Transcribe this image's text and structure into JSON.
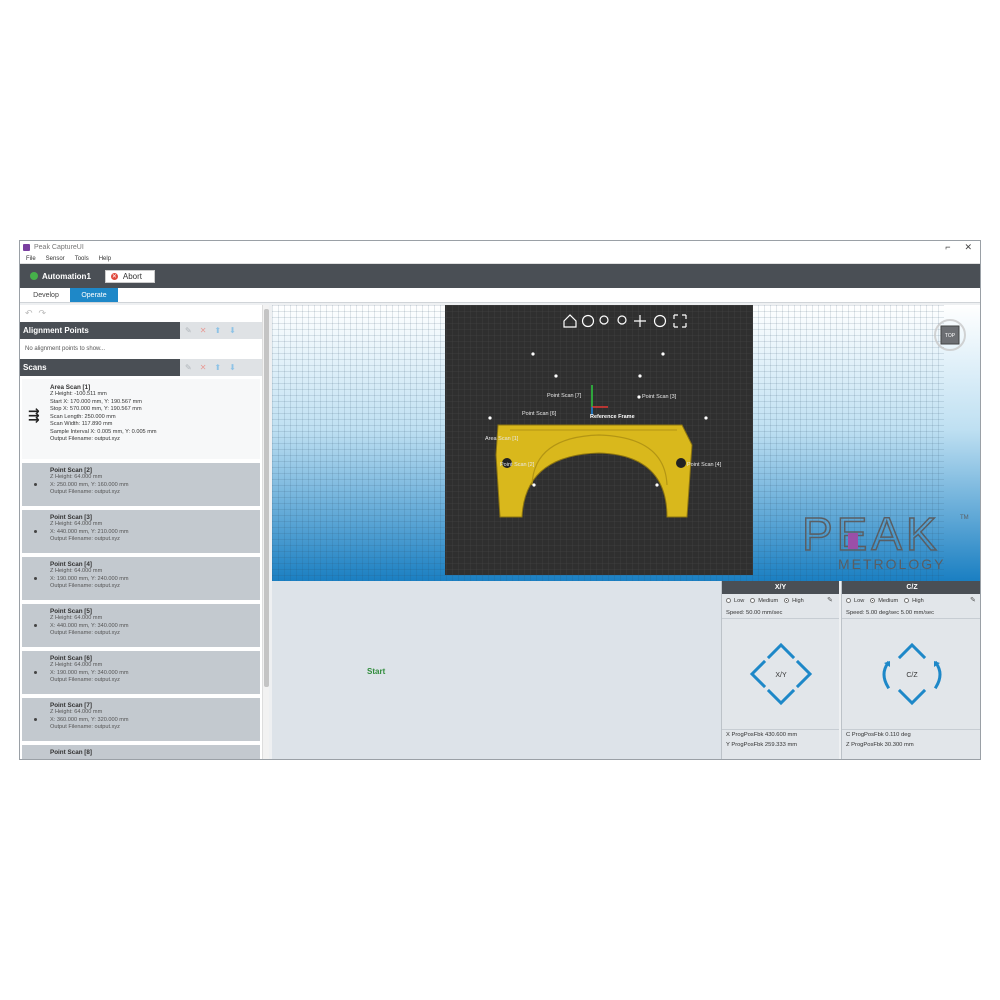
{
  "window": {
    "title": "Peak CaptureUI",
    "min_glyph": "⌐",
    "close_glyph": "✕"
  },
  "menu": [
    "File",
    "Sensor",
    "Tools",
    "Help"
  ],
  "automation": {
    "name": "Automation1",
    "abort_label": "Abort"
  },
  "tabs": [
    {
      "label": "Develop",
      "active": false
    },
    {
      "label": "Operate",
      "active": true
    }
  ],
  "alignment": {
    "title": "Alignment Points",
    "empty_text": "No alignment points to show..."
  },
  "scans": {
    "title": "Scans",
    "items": [
      {
        "name": "Area Scan [1]",
        "lines": [
          "Z Height: -100.511 mm",
          "Start X: 170.000 mm, Y: 190.567 mm",
          "Stop X: 570.000 mm, Y: 190.567 mm",
          "Scan Length: 250.000 mm",
          "Scan Width: 117.890 mm",
          "Sample Interval X: 0.005 mm, Y: 0.005 mm",
          "Output Filename: output.xyz"
        ]
      },
      {
        "name": "Point Scan [2]",
        "lines": [
          "Z Height: 64.000 mm",
          "X: 250.000 mm, Y: 160.000 mm",
          "Output Filename: output.xyz"
        ]
      },
      {
        "name": "Point Scan [3]",
        "lines": [
          "Z Height: 64.000 mm",
          "X: 440.000 mm, Y: 210.000 mm",
          "Output Filename: output.xyz"
        ]
      },
      {
        "name": "Point Scan [4]",
        "lines": [
          "Z Height: 64.000 mm",
          "X: 190.000 mm, Y: 240.000 mm",
          "Output Filename: output.xyz"
        ]
      },
      {
        "name": "Point Scan [5]",
        "lines": [
          "Z Height: 64.000 mm",
          "X: 440.000 mm, Y: 340.000 mm",
          "Output Filename: output.xyz"
        ]
      },
      {
        "name": "Point Scan [6]",
        "lines": [
          "Z Height: 64.000 mm",
          "X: 190.000 mm, Y: 340.000 mm",
          "Output Filename: output.xyz"
        ]
      },
      {
        "name": "Point Scan [7]",
        "lines": [
          "Z Height: 64.000 mm",
          "X: 360.000 mm, Y: 320.000 mm",
          "Output Filename: output.xyz"
        ]
      },
      {
        "name": "Point Scan [8]",
        "lines": []
      }
    ]
  },
  "viewport": {
    "cube_label": "TOP",
    "part_color": "#d9b81c",
    "labels": [
      "Point Scan [7]",
      "Point Scan [6]",
      "Point Scan [3]",
      "Area Scan [1]",
      "Point Scan [2]",
      "Point Scan [4]",
      "Reference Frame"
    ],
    "icons": [
      "home-icon",
      "orbit-icon",
      "zoom-window-icon",
      "zoom-icon",
      "pan-icon",
      "rotate-icon",
      "fit-icon"
    ]
  },
  "brand": {
    "peak": "PEAK",
    "metrology": "METROLOGY",
    "tm": "TM"
  },
  "start_label": "Start",
  "xy": {
    "title": "X/Y",
    "options": [
      "Low",
      "Medium",
      "High"
    ],
    "selected": "High",
    "speed": "Speed: 50.00 mm/sec",
    "pad_label": "X/Y",
    "pos_x": "X ProgPosFbk 430.600 mm",
    "pos_y": "Y ProgPosFbk 259.333 mm"
  },
  "cz": {
    "title": "C/Z",
    "options": [
      "Low",
      "Medium",
      "High"
    ],
    "selected": "Medium",
    "speed": "Speed: 5.00 deg/sec 5.00 mm/sec",
    "pad_label": "C/Z",
    "pos_c": "C ProgPosFbk   0.110 deg",
    "pos_z": "Z ProgPosFbk 30.300 mm"
  },
  "colors": {
    "accent": "#1e88c8",
    "dark_bar": "#4a4f55",
    "start": "#2e8b3a",
    "brand_purple": "#9b4fa8"
  }
}
